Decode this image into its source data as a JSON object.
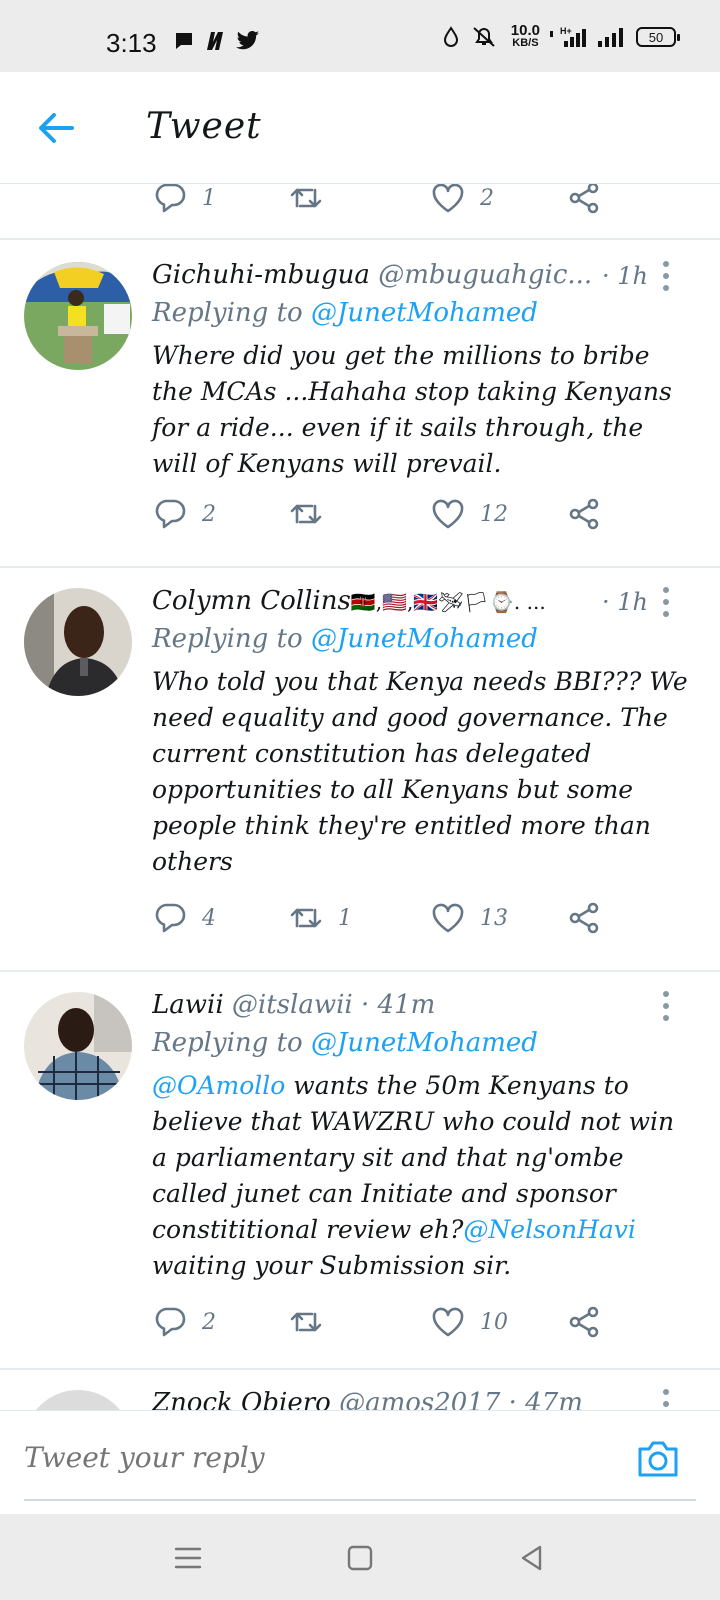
{
  "status_bar": {
    "time": "3:13",
    "speed_value": "10.0",
    "speed_unit": "KB/S",
    "network": "H+",
    "battery": "50"
  },
  "header": {
    "title": "Tweet",
    "back_icon": "arrow-left-icon"
  },
  "top_partial_actions": {
    "reply_count": "1",
    "retweet_count": "",
    "like_count": "2"
  },
  "replies": [
    {
      "name": "Gichuhi-mbugua",
      "handle": "@mbuguahgic...",
      "time": "· 1h",
      "replying_prefix": "Replying to",
      "replying_to": "@JunetMohamed",
      "text": "Where did you get the millions to bribe the MCAs ...Hahaha stop taking Kenyans for a ride... even if it sails through, the will of Kenyans will prevail.",
      "reply_count": "2",
      "retweet_count": "",
      "like_count": "12"
    },
    {
      "name": "Colymn Collins",
      "name_suffix": "🇰🇪,🇺🇸,🇬🇧🛩🏳⌚. ...",
      "time": "· 1h",
      "replying_prefix": "Replying to",
      "replying_to": "@JunetMohamed",
      "text": "Who told you that Kenya needs BBI??? We need equality and good governance. The current constitution has delegated opportunities to all Kenyans but some people think they're entitled more than others",
      "reply_count": "4",
      "retweet_count": "1",
      "like_count": "13"
    },
    {
      "name": "Lawii",
      "handle": "@itslawii",
      "time": "· 41m",
      "replying_prefix": "Replying to",
      "replying_to": "@JunetMohamed",
      "text_mention_1": "@OAmollo",
      "text_part_1": " wants the 50m Kenyans to believe that WAWZRU who could not win a parliamentary sit and that ng'ombe called junet can Initiate and sponsor constititional review eh?",
      "text_mention_2": "@NelsonHavi",
      "text_part_2": " waiting your Submission sir.",
      "reply_count": "2",
      "retweet_count": "",
      "like_count": "10"
    },
    {
      "name": "Znock Obiero",
      "handle": "@amos2017 · 47m"
    }
  ],
  "composer": {
    "placeholder": "Tweet your reply",
    "camera_icon": "camera-icon"
  },
  "colors": {
    "accent": "#1da1f2",
    "secondary_text": "#657786",
    "divider": "#e6ecf0"
  }
}
